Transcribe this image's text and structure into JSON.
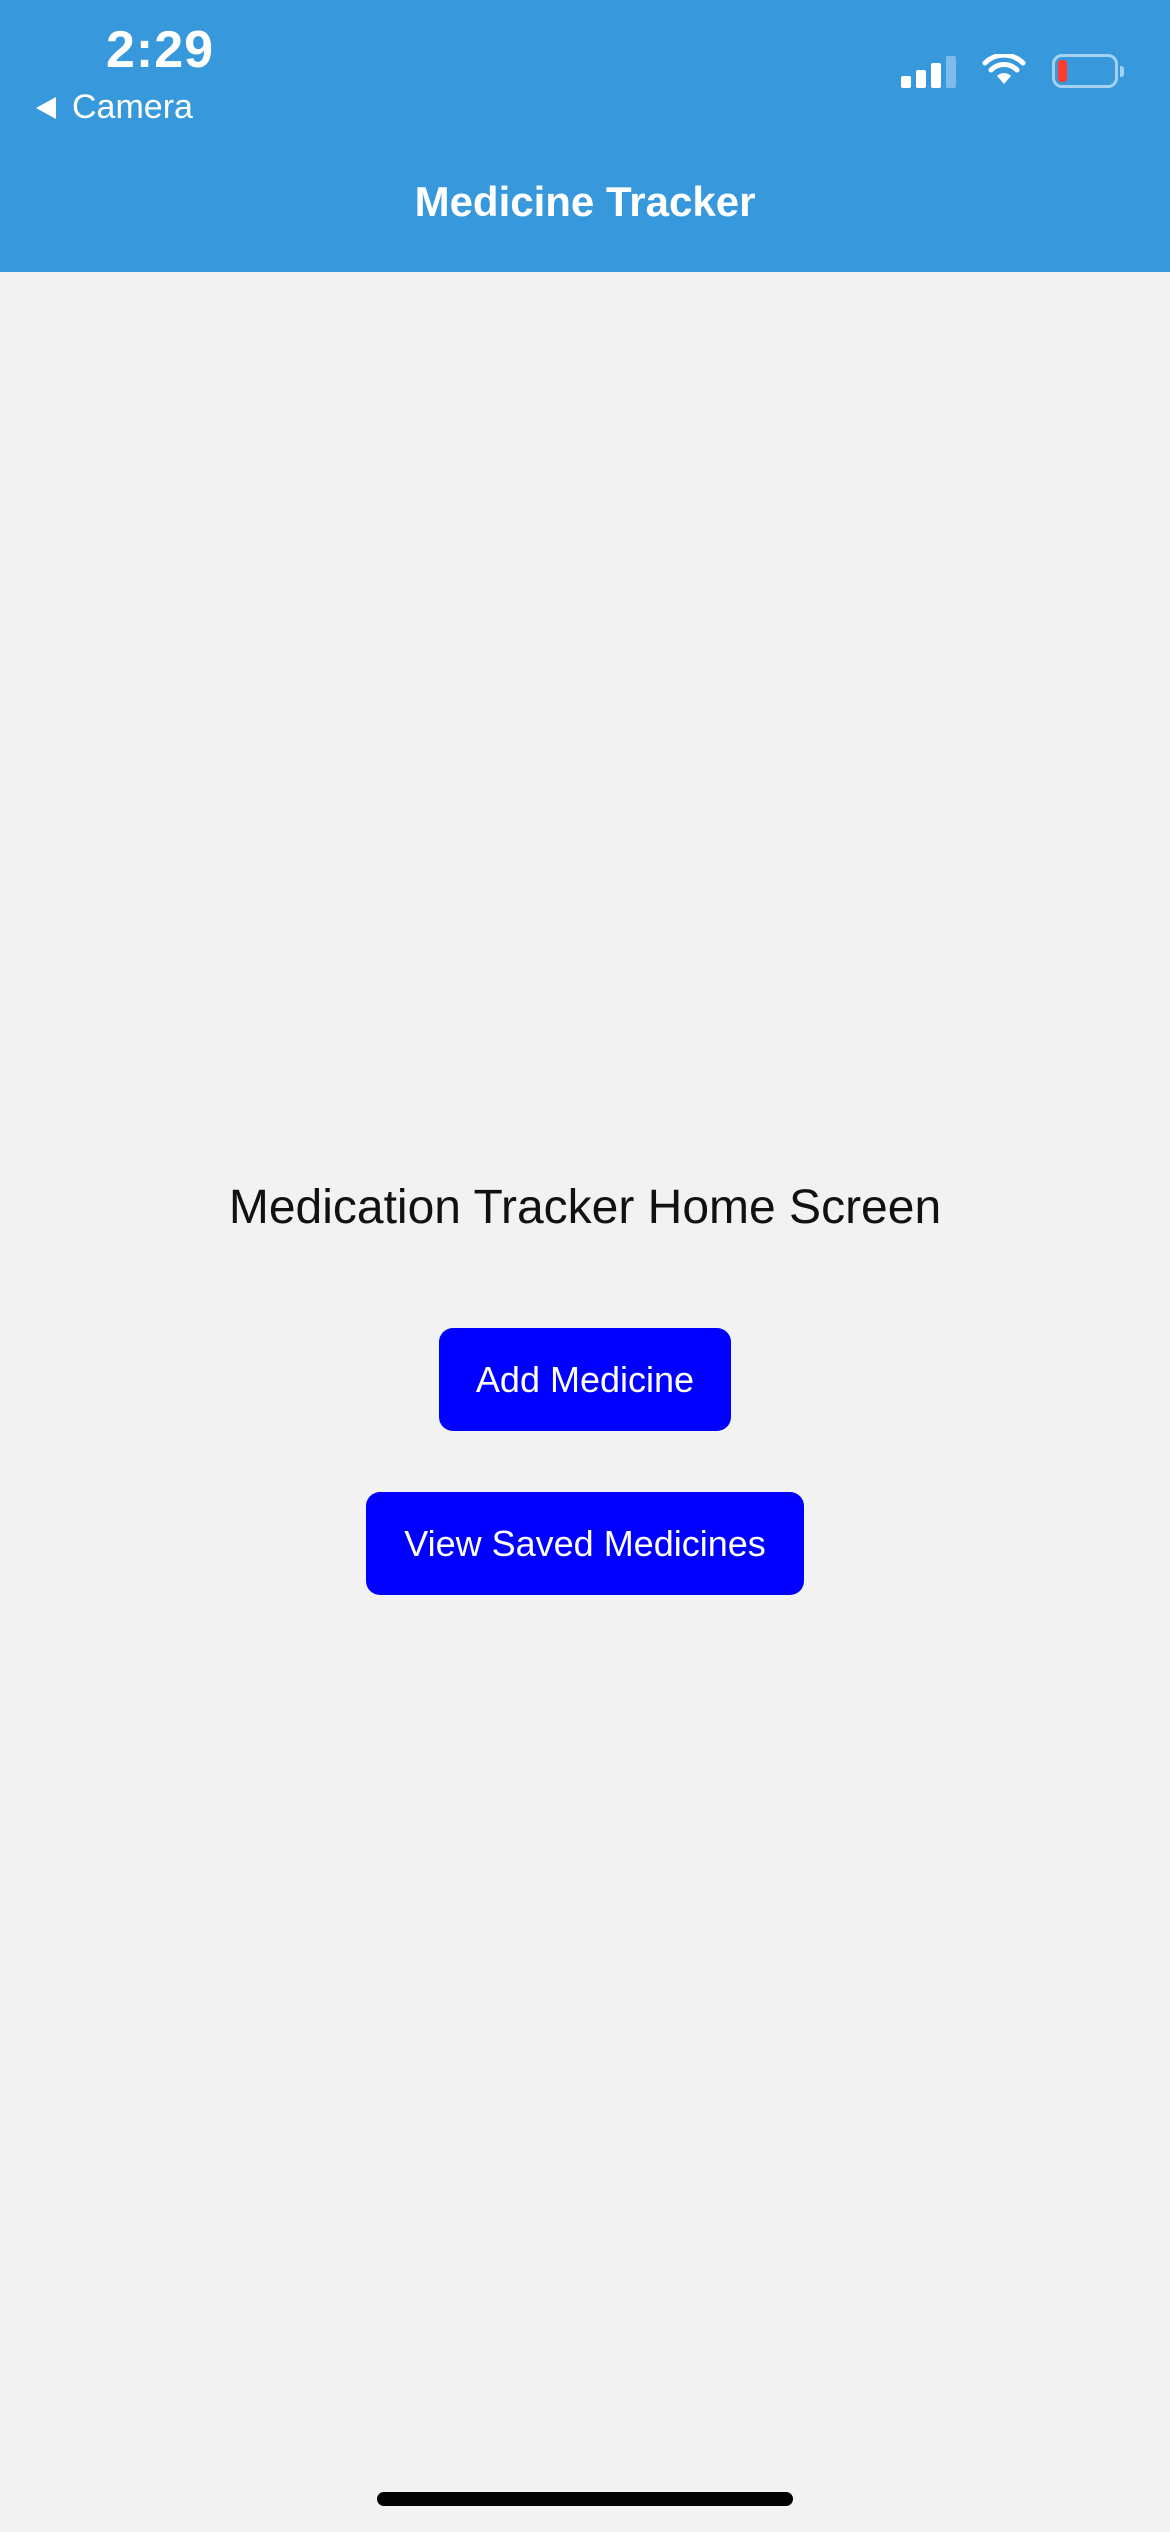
{
  "status_bar": {
    "time": "2:29",
    "back_app_label": "Camera",
    "icons": [
      "signal-icon",
      "wifi-icon",
      "battery-icon"
    ],
    "battery_color": "#ff3b30"
  },
  "nav": {
    "title": "Medicine Tracker"
  },
  "main": {
    "heading": "Medication Tracker Home Screen",
    "add_button_label": "Add Medicine",
    "view_button_label": "View Saved Medicines"
  },
  "colors": {
    "header_background": "#3799dc",
    "screen_background": "#f2f2f2",
    "button_background": "#0000ff",
    "button_text": "#ffffff"
  }
}
